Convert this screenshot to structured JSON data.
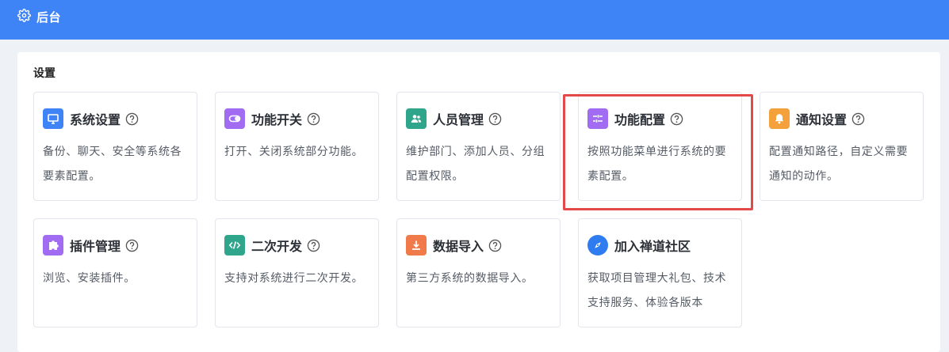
{
  "header": {
    "title": "后台"
  },
  "section": {
    "title": "设置"
  },
  "cards": [
    {
      "name": "系统设置",
      "desc": "备份、聊天、安全等系统各要素配置。",
      "icon": "monitor-icon",
      "color": "#3f84f7",
      "help": true
    },
    {
      "name": "功能开关",
      "desc": "打开、关闭系统部分功能。",
      "icon": "toggle-icon",
      "color": "#a26cf2",
      "help": true
    },
    {
      "name": "人员管理",
      "desc": "维护部门、添加人员、分组配置权限。",
      "icon": "users-icon",
      "color": "#2fa58c",
      "help": true
    },
    {
      "name": "功能配置",
      "desc": "按照功能菜单进行系统的要素配置。",
      "icon": "sliders-icon",
      "color": "#a26cf2",
      "help": true
    },
    {
      "name": "通知设置",
      "desc": "配置通知路径，自定义需要通知的动作。",
      "icon": "bell-icon",
      "color": "#f4a13b",
      "help": true
    },
    {
      "name": "插件管理",
      "desc": "浏览、安装插件。",
      "icon": "puzzle-icon",
      "color": "#a26cf2",
      "help": true
    },
    {
      "name": "二次开发",
      "desc": "支持对系统进行二次开发。",
      "icon": "code-icon",
      "color": "#2fa58c",
      "help": true
    },
    {
      "name": "数据导入",
      "desc": "第三方系统的数据导入。",
      "icon": "download-icon",
      "color": "#f07a4a",
      "help": true
    },
    {
      "name": "加入禅道社区",
      "desc": "获取项目管理大礼包、技术支持服务、体验各版本",
      "icon": "compass-icon",
      "color": "#2f7cf0",
      "help": false
    }
  ]
}
